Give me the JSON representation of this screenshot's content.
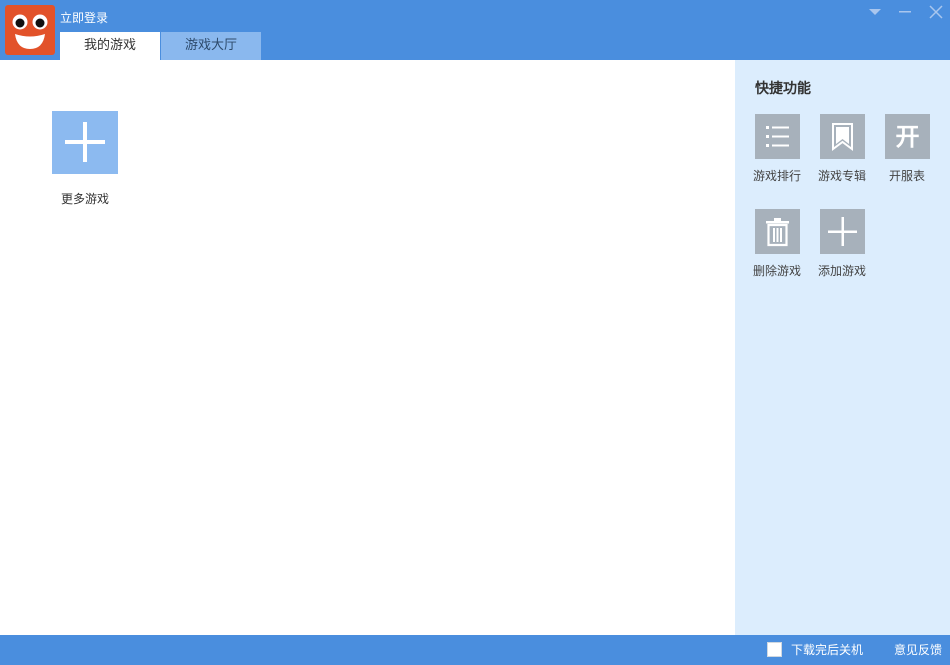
{
  "header": {
    "login_text": "立即登录",
    "tabs": [
      {
        "label": "我的游戏",
        "active": true
      },
      {
        "label": "游戏大厅",
        "active": false
      }
    ],
    "controls": [
      "dropdown-icon",
      "minimize-icon",
      "close-icon"
    ]
  },
  "main": {
    "tiles": [
      {
        "label": "更多游戏",
        "icon": "plus-icon"
      }
    ]
  },
  "sidebar": {
    "title": "快捷功能",
    "items": [
      {
        "label": "游戏排行",
        "icon": "list-icon"
      },
      {
        "label": "游戏专辑",
        "icon": "bookmark-icon"
      },
      {
        "label": "开服表",
        "icon": "kai-icon",
        "glyph": "开"
      },
      {
        "label": "删除游戏",
        "icon": "trash-icon"
      },
      {
        "label": "添加游戏",
        "icon": "plus-icon"
      }
    ]
  },
  "footer": {
    "shutdown_label": "下载完后关机",
    "shutdown_checked": false,
    "feedback_label": "意见反馈"
  },
  "colors": {
    "header_bg": "#4a8ede",
    "sidebar_bg": "#dcedfd",
    "tile_bg": "#8cbaf0",
    "quick_icon_bg": "#a7b1bb",
    "avatar_bg": "#e2522a"
  }
}
